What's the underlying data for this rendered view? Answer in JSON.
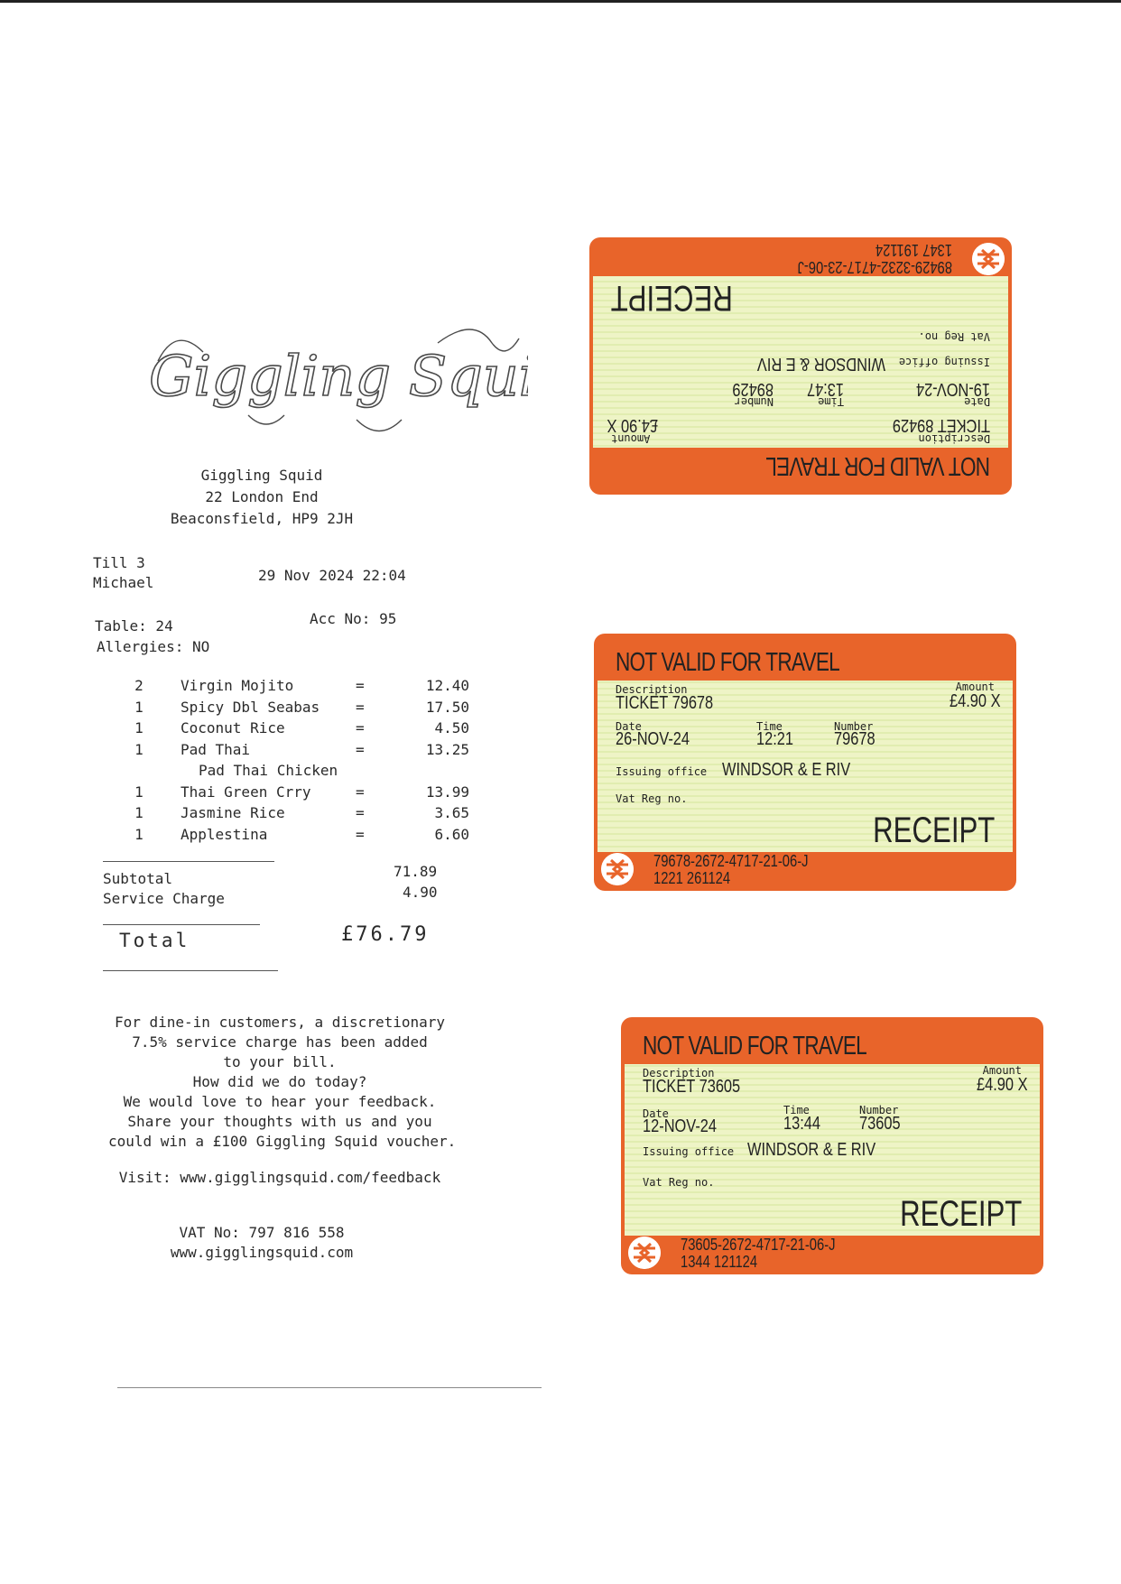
{
  "receipt": {
    "logo_text": "Giggling Squid",
    "address": [
      "Giggling Squid",
      "22 London End",
      "Beaconsfield, HP9 2JH"
    ],
    "till": "Till 3",
    "server": "Michael",
    "datetime": "29 Nov 2024 22:04",
    "table": "Table: 24",
    "acc_no": "Acc No: 95",
    "allergies": "Allergies: NO",
    "items": [
      {
        "qty": "2",
        "name": "Virgin Mojito",
        "eq": "=",
        "price": "12.40"
      },
      {
        "qty": "1",
        "name": "Spicy Dbl Seabas",
        "eq": "=",
        "price": "17.50"
      },
      {
        "qty": "1",
        "name": "Coconut Rice",
        "eq": "=",
        "price": "4.50"
      },
      {
        "qty": "1",
        "name": "Pad Thai",
        "eq": "=",
        "price": "13.25"
      },
      {
        "qty": "",
        "name": "Pad Thai Chicken",
        "eq": "",
        "price": ""
      },
      {
        "qty": "1",
        "name": "Thai Green Crry",
        "eq": "=",
        "price": "13.99"
      },
      {
        "qty": "1",
        "name": "Jasmine Rice",
        "eq": "=",
        "price": "3.65"
      },
      {
        "qty": "1",
        "name": "Applestina",
        "eq": "=",
        "price": "6.60"
      }
    ],
    "subtotal_label": "Subtotal",
    "subtotal": "71.89",
    "service_label": "Service Charge",
    "service": "4.90",
    "total_label": "Total",
    "total": "£76.79",
    "footer": [
      "For dine-in customers, a discretionary",
      "7.5% service charge has been added",
      "to your bill.",
      "How did we do today?",
      "We would love to hear your feedback.",
      "Share your thoughts with us and you",
      "could win a £100 Giggling Squid voucher."
    ],
    "visit": "Visit: www.gigglingsquid.com/feedback",
    "vat_no": "VAT No: 797 816 558",
    "website": "www.gigglingsquid.com"
  },
  "tickets": [
    {
      "not_valid": "NOT VALID FOR TRAVEL",
      "description_label": "Description",
      "description": "TICKET 89429",
      "amount_label": "Amount",
      "amount": "£4.90  X",
      "date_label": "Date",
      "date": "19-NOV-24",
      "time_label": "Time",
      "time": "13:47",
      "number_label": "Number",
      "number": "89429",
      "issuing_label": "Issuing office",
      "issuing_office": "WINDSOR & E RIV",
      "vat_label": "Vat Reg no.",
      "receipt": "RECEIPT",
      "ref": "89429-3232-4717-23-06-J",
      "ref2": "1347 191124"
    },
    {
      "not_valid": "NOT VALID FOR TRAVEL",
      "description_label": "Description",
      "description": "TICKET 79678",
      "amount_label": "Amount",
      "amount": "£4.90  X",
      "date_label": "Date",
      "date": "26-NOV-24",
      "time_label": "Time",
      "time": "12:21",
      "number_label": "Number",
      "number": "79678",
      "issuing_label": "Issuing office",
      "issuing_office": "WINDSOR & E RIV",
      "vat_label": "Vat Reg no.",
      "receipt": "RECEIPT",
      "ref": "79678-2672-4717-21-06-J",
      "ref2": "1221 261124"
    },
    {
      "not_valid": "NOT VALID FOR TRAVEL",
      "description_label": "Description",
      "description": "TICKET 73605",
      "amount_label": "Amount",
      "amount": "£4.90  X",
      "date_label": "Date",
      "date": "12-NOV-24",
      "time_label": "Time",
      "time": "13:44",
      "number_label": "Number",
      "number": "73605",
      "issuing_label": "Issuing office",
      "issuing_office": "WINDSOR & E RIV",
      "vat_label": "Vat Reg no.",
      "receipt": "RECEIPT",
      "ref": "73605-2672-4717-21-06-J",
      "ref2": "1344 121124"
    }
  ],
  "colors": {
    "ticket_orange": "#e8642a",
    "ticket_panel": "#eef4c6"
  }
}
